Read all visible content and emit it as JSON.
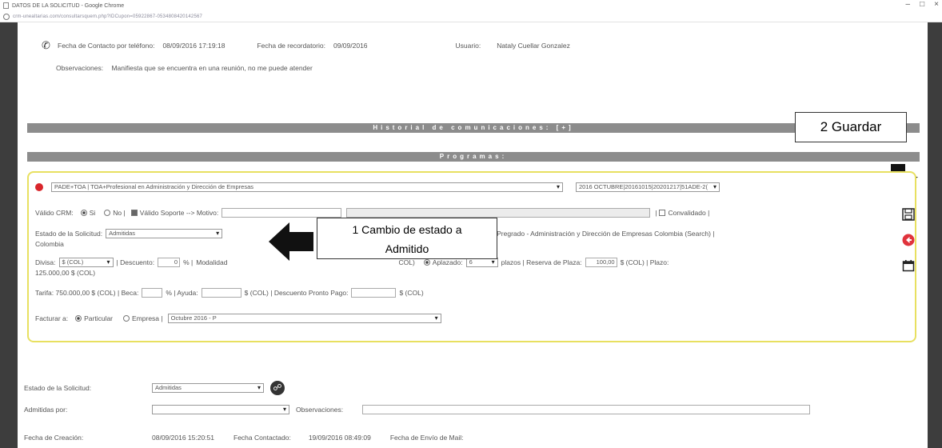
{
  "window": {
    "title": "DATOS DE LA SOLICITUD - Google Chrome",
    "url": "crm-unealtarias.com/consultarsquem.php?IDCupon=05922867-0534808420142567",
    "controls": [
      "–",
      "□",
      "×"
    ]
  },
  "contact": {
    "fecha_contacto_label": "Fecha de Contacto por teléfono:",
    "fecha_contacto_value": "08/09/2016 17:19:18",
    "fecha_recordatorio_label": "Fecha de recordatorio:",
    "fecha_recordatorio_value": "09/09/2016",
    "usuario_label": "Usuario:",
    "usuario_value": "Nataly Cuellar Gonzalez",
    "observaciones_label": "Observaciones:",
    "observaciones_value": "Manifiesta que se encuentra en una reunión, no me puede atender"
  },
  "banners": {
    "historial": "Historial de comunicaciones: [+]",
    "programas": "Programas:"
  },
  "callouts": {
    "guardar": "2 Guardar",
    "cambio_line1": "1 Cambio de estado a",
    "cambio_line2": "Admitido"
  },
  "programa": {
    "select_value": "PADE+TOA | TOA+Profesional en Administración y Dirección de Empresas",
    "convocatoria_value": "2016 OCTUBRE|20161015|20201217|51ADE-2(",
    "valido_crm_label": "Válido CRM:",
    "si": "Si",
    "no": "No |",
    "valido_soporte": "Válido Soporte --> Motivo:",
    "convalidado": "Convalidado |",
    "estado_label": "Estado de la Solicitud:",
    "estado_value": "Admitidas",
    "origen_text": "CO - Quark - Pregrado - Administración y Dirección de Empresas Colombia (Search) |",
    "colombia": "Colombia",
    "divisa_label": "Divisa:",
    "divisa_value": "$ (COL)",
    "descuento_label": "| Descuento:",
    "descuento_value": "0",
    "percent": "% |",
    "modalidad_label": "Modalidad",
    "col_label": "COL)",
    "aplazado_label": "Aplazado:",
    "plazos_value": "6",
    "plazos_text": "plazos | Reserva de Plaza:",
    "reserva_value": "100,00",
    "reserva_unit": "$ (COL) | Plazo:",
    "plazo_amount": "125.000,00 $ (COL)",
    "tarifa_text": "Tarifa: 750.000,00 $ (COL) | Beca:",
    "beca_unit": "% | Ayuda:",
    "ayuda_unit": "$ (COL) | Descuento Pronto Pago:",
    "pronto_unit": "$ (COL)",
    "facturar_label": "Facturar a:",
    "particular": "Particular",
    "empresa": "Empresa |",
    "facturar_value": "Octubre 2016 - P"
  },
  "footer": {
    "estado_label": "Estado de la Solicitud:",
    "estado_value": "Admitidas",
    "admitidas_por_label": "Admitidas por:",
    "observaciones_label": "Observaciones:",
    "fecha_creacion_label": "Fecha de Creación:",
    "fecha_creacion_value": "08/09/2016 15:20:51",
    "fecha_contactado_label": "Fecha Contactado:",
    "fecha_contactado_value": "19/09/2016 08:49:09",
    "fecha_envio_label": "Fecha de Envío de Mail:"
  }
}
